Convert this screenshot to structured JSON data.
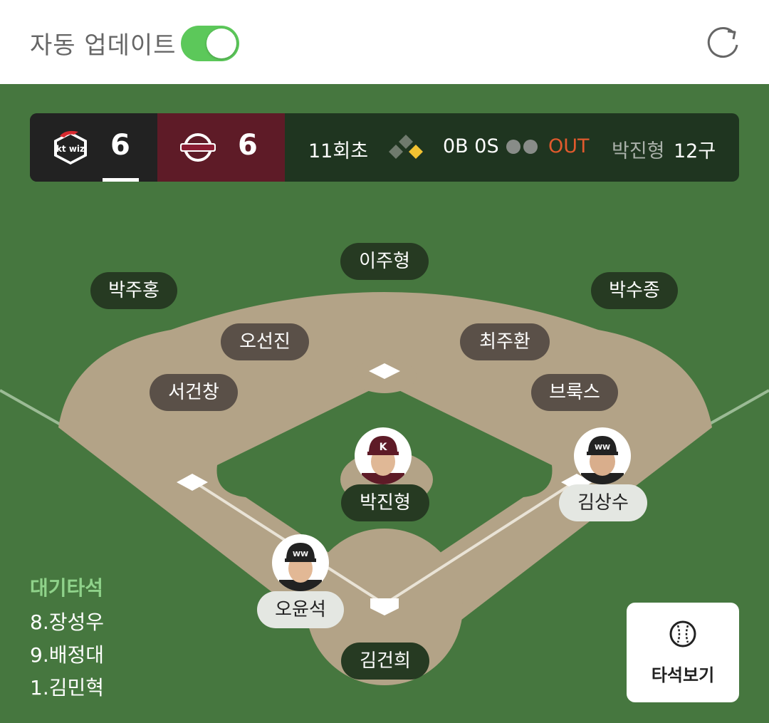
{
  "header": {
    "auto_update_label": "자동 업데이트",
    "auto_update_on": true,
    "refresh_icon": "refresh-icon"
  },
  "scoreboard": {
    "away": {
      "logo_icon": "kt-wiz-logo",
      "score": "6",
      "color": "#222222",
      "active": true
    },
    "home": {
      "logo_icon": "kiwoom-heroes-logo",
      "score": "6",
      "color": "#5e1b27"
    },
    "inning": "11회초",
    "count": "0B 0S",
    "outs": 0,
    "out_label": "OUT",
    "out_color": "#e15a2d",
    "pitcher": "박진형",
    "pitch_count": "12구",
    "bases": {
      "first": false,
      "second": false,
      "third": true
    }
  },
  "fielders": {
    "center": "이주형",
    "left": "박주홍",
    "right": "박수종",
    "shortstop": "오선진",
    "second_base": "최주환",
    "third_base": "서건창",
    "first_base": "브룩스",
    "pitcher": "박진형",
    "catcher": "김건희"
  },
  "runners": {
    "first": "김상수",
    "batter": "오윤석"
  },
  "on_deck": {
    "title": "대기타석",
    "items": [
      "8.장성우",
      "9.배정대",
      "1.김민혁"
    ]
  },
  "lineup_button": {
    "label": "타석보기",
    "icon": "baseball-icon"
  },
  "colors": {
    "field_green": "#46773f",
    "dirt": "#b3a387",
    "toggle_green": "#5cc85a"
  }
}
